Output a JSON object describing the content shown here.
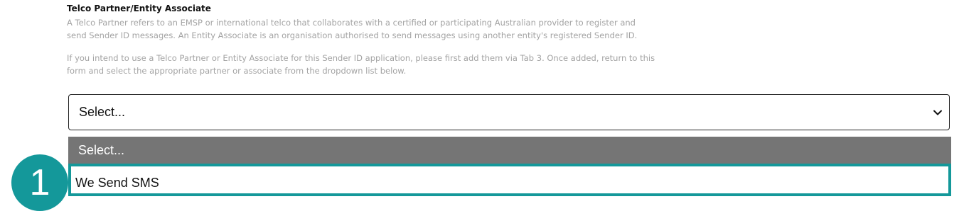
{
  "section": {
    "title": "Telco Partner/Entity Associate",
    "description": "A Telco Partner refers to an EMSP or international telco that collaborates with a certified or participating Australian provider to register and send Sender ID messages. An Entity Associate is an organisation authorised to send messages using another entity's registered Sender ID.",
    "instructions": "If you intend to use a Telco Partner or Entity Associate for this Sender ID application, please first add them via Tab 3. Once added, return to this form and select the appropriate partner or associate from the dropdown list below."
  },
  "select": {
    "value": "Select...",
    "icon": "chevron-down-icon",
    "options": [
      {
        "label": "Select...",
        "state": "highlighted"
      },
      {
        "label": "We Send SMS",
        "state": "outlined"
      }
    ]
  },
  "annotation": {
    "step_number": "1",
    "color": "#14989a"
  },
  "colors": {
    "accent": "#14989a",
    "highlight": "#757575",
    "muted_text": "#a3a3a3"
  }
}
